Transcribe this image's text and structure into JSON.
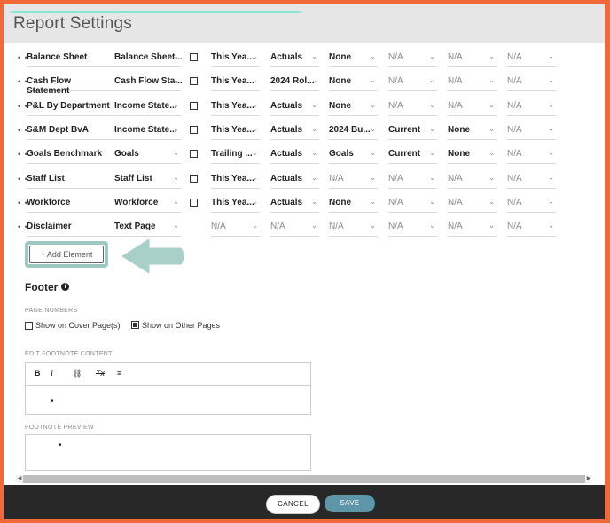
{
  "header": {
    "title": "Report Settings"
  },
  "rows": [
    {
      "name": "Balance Sheet",
      "cols": [
        "Balance Sheet...",
        "",
        "This Yea...",
        "Actuals",
        "None",
        "N/A",
        "N/A",
        "N/A"
      ],
      "grey": [
        false,
        false,
        false,
        false,
        false,
        true,
        true,
        true
      ]
    },
    {
      "name": "Cash Flow Statement",
      "cols": [
        "Cash Flow Sta...",
        "",
        "This Yea...",
        "2024 Rol...",
        "None",
        "N/A",
        "N/A",
        "N/A"
      ],
      "grey": [
        false,
        false,
        false,
        false,
        false,
        true,
        true,
        true
      ]
    },
    {
      "name": "P&L By Department",
      "cols": [
        "Income State...",
        "",
        "This Yea...",
        "Actuals",
        "None",
        "N/A",
        "N/A",
        "N/A"
      ],
      "grey": [
        false,
        false,
        false,
        false,
        false,
        true,
        true,
        true
      ]
    },
    {
      "name": "S&M Dept BvA",
      "cols": [
        "Income State...",
        "",
        "This Yea...",
        "Actuals",
        "2024 Bu...",
        "Current",
        "None",
        "N/A"
      ],
      "grey": [
        false,
        false,
        false,
        false,
        false,
        false,
        false,
        true
      ]
    },
    {
      "name": "Goals Benchmark",
      "cols": [
        "Goals",
        "",
        "Trailing ...",
        "Actuals",
        "Goals",
        "Current",
        "None",
        "N/A"
      ],
      "grey": [
        false,
        false,
        false,
        false,
        false,
        false,
        false,
        true
      ]
    },
    {
      "name": "Staff List",
      "cols": [
        "Staff List",
        "",
        "This Yea...",
        "Actuals",
        "N/A",
        "N/A",
        "N/A",
        "N/A"
      ],
      "grey": [
        false,
        false,
        false,
        false,
        true,
        true,
        true,
        true
      ]
    },
    {
      "name": "Workforce",
      "cols": [
        "Workforce",
        "",
        "This Yea...",
        "Actuals",
        "None",
        "N/A",
        "N/A",
        "N/A"
      ],
      "grey": [
        false,
        false,
        false,
        false,
        false,
        true,
        true,
        true
      ]
    },
    {
      "name": "Disclaimer",
      "cols": [
        "Text Page",
        "",
        "N/A",
        "N/A",
        "N/A",
        "N/A",
        "N/A",
        "N/A"
      ],
      "grey": [
        false,
        false,
        true,
        true,
        true,
        true,
        true,
        true
      ]
    }
  ],
  "add_element": {
    "label": "+ Add Element"
  },
  "footer": {
    "title": "Footer",
    "info_icon": "i",
    "page_numbers_label": "PAGE NUMBERS",
    "cover_option": "Show on Cover Page(s)",
    "other_option": "Show on Other Pages",
    "cover_checked": false,
    "other_checked": true,
    "edit_label": "EDIT FOOTNOTE CONTENT",
    "toolbar": {
      "bold": "B",
      "italic": "I",
      "link": "⛓",
      "clear": "Tx",
      "align": "≡"
    },
    "editor_content": "•",
    "preview_label": "FOOTNOTE PREVIEW",
    "preview_content": "•"
  },
  "actions": {
    "cancel": "CANCEL",
    "save": "SAVE"
  },
  "colors": {
    "accent": "#5d96a8",
    "highlight": "#9ec9c3",
    "border": "#f1683a"
  }
}
